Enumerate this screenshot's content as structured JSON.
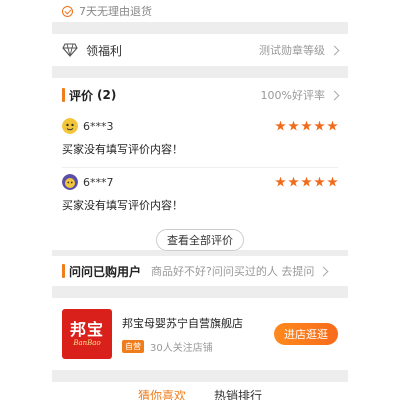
{
  "guarantee": {
    "text": "7天无理由退货"
  },
  "benefit": {
    "label": "领福利",
    "right_text": "测试勋章等级"
  },
  "reviews": {
    "title": "评价",
    "count": "(2)",
    "rate": "100%好评率",
    "items": [
      {
        "user": "6***3",
        "stars": 5,
        "text": "买家没有填写评价内容！"
      },
      {
        "user": "6***7",
        "stars": 5,
        "text": "买家没有填写评价内容！"
      }
    ],
    "all_button": "查看全部评价"
  },
  "qa": {
    "title": "问问已购用户",
    "hint": "商品好不好?问问买过的人  去提问"
  },
  "shop": {
    "logo_text": "邦宝",
    "logo_sub": "BanBao",
    "name": "邦宝母婴苏宁自营旗舰店",
    "badge": "自营",
    "followers": "30人关注店铺",
    "enter_button": "进店逛逛"
  },
  "tabs": {
    "active": "猜你喜欢",
    "other": "热销排行"
  },
  "colors": {
    "accent": "#f07d1b",
    "star": "#f06a1a",
    "logo_bg": "#d9201b"
  }
}
